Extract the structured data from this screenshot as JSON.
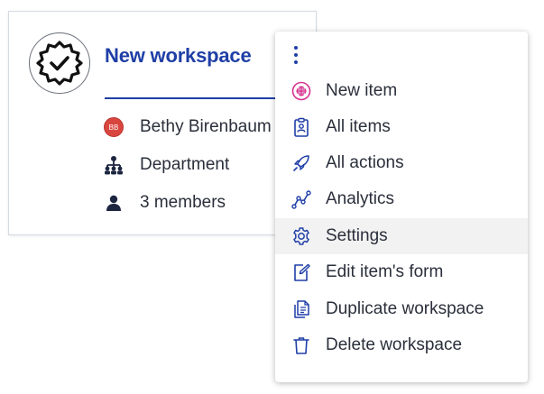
{
  "workspace": {
    "title": "New workspace",
    "owner_initials": "BB",
    "owner_name": "Bethy Birenbaum",
    "type": "Department",
    "members": "3 members"
  },
  "menu": {
    "items": [
      {
        "label": "New item",
        "icon": "plus-circle-icon"
      },
      {
        "label": "All items",
        "icon": "clipboard-icon"
      },
      {
        "label": "All actions",
        "icon": "rocket-icon"
      },
      {
        "label": "Analytics",
        "icon": "analytics-icon"
      },
      {
        "label": "Settings",
        "icon": "gear-icon",
        "hovered": true
      },
      {
        "label": "Edit item's form",
        "icon": "edit-form-icon"
      },
      {
        "label": "Duplicate workspace",
        "icon": "duplicate-icon"
      },
      {
        "label": "Delete workspace",
        "icon": "trash-icon"
      }
    ]
  },
  "colors": {
    "accent": "#1f3fa6",
    "new_item_icon": "#d6338f",
    "avatar": "#d9463f",
    "hover_bg": "#f2f2f2"
  }
}
